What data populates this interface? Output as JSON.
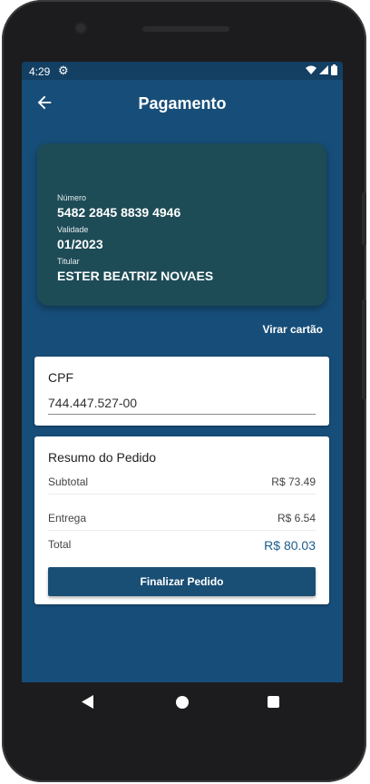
{
  "status_bar": {
    "time": "4:29",
    "settings_icon": "gear-icon",
    "wifi_icon": "wifi-icon",
    "signal_icon": "signal-icon",
    "battery_icon": "battery-icon"
  },
  "app_bar": {
    "title": "Pagamento",
    "back_icon": "arrow-left-icon"
  },
  "credit_card": {
    "number_label": "Número",
    "number": "5482 2845 8839 4946",
    "expiry_label": "Validade",
    "expiry": "01/2023",
    "holder_label": "Titular",
    "holder": "ESTER BEATRIZ NOVAES",
    "background_color": "#1d4b56"
  },
  "flip_card_label": "Virar cartão",
  "cpf": {
    "label": "CPF",
    "value": "744.447.527-00"
  },
  "summary": {
    "title": "Resumo do Pedido",
    "subtotal_label": "Subtotal",
    "subtotal_value": "R$ 73.49",
    "delivery_label": "Entrega",
    "delivery_value": "R$ 6.54",
    "total_label": "Total",
    "total_value": "R$ 80.03",
    "button_label": "Finalizar Pedido"
  },
  "colors": {
    "screen_background": "#174e79",
    "status_bar": "#133f63",
    "button": "#1a4f75",
    "total_accent": "#1b5d8b"
  },
  "nav_bar": {
    "back_icon": "triangle-back-icon",
    "home_icon": "circle-home-icon",
    "recents_icon": "square-recents-icon"
  }
}
